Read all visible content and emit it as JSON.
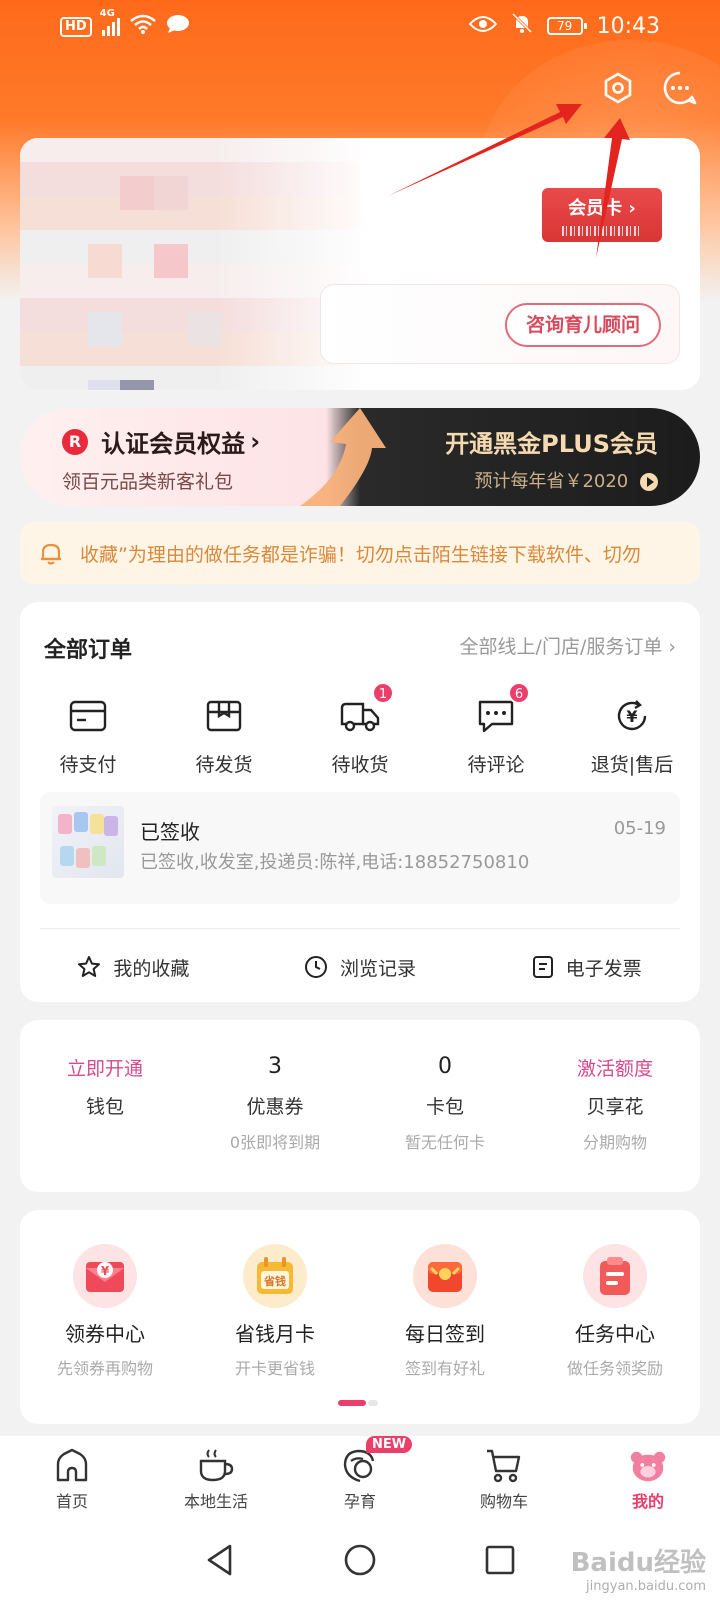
{
  "status_bar": {
    "hd": "HD",
    "network": "4G",
    "battery": "79",
    "time": "10:43"
  },
  "profile": {
    "member_card_label": "会员卡",
    "advisor_button": "咨询育儿顾问"
  },
  "banner": {
    "left_title": "认证会员权益",
    "left_sub": "领百元品类新客礼包",
    "right_title": "开通黑金PLUS会员",
    "right_sub": "预计每年省￥2020",
    "r_letter": "R"
  },
  "notice": {
    "text": "收藏”为理由的做任务都是诈骗！切勿点击陌生链接下载软件、切勿"
  },
  "orders": {
    "title": "全部订单",
    "all_link": "全部线上/门店/服务订单",
    "items": [
      {
        "label": "待支付",
        "badge": ""
      },
      {
        "label": "待发货",
        "badge": ""
      },
      {
        "label": "待收货",
        "badge": "1"
      },
      {
        "label": "待评论",
        "badge": "6"
      },
      {
        "label": "退货|售后",
        "badge": ""
      }
    ],
    "shipment": {
      "status": "已签收",
      "date": "05-19",
      "detail": "已签收,收发室,投递员:陈祥,电话:18852750810"
    },
    "quick_links": [
      "我的收藏",
      "浏览记录",
      "电子发票"
    ]
  },
  "wallet": [
    {
      "value": "立即开通",
      "name": "钱包",
      "sub": ""
    },
    {
      "value": "3",
      "name": "优惠券",
      "sub": "0张即将到期"
    },
    {
      "value": "0",
      "name": "卡包",
      "sub": "暂无任何卡"
    },
    {
      "value": "激活额度",
      "name": "贝享花",
      "sub": "分期购物"
    }
  ],
  "tasks": [
    {
      "name": "领券中心",
      "sub": "先领券再购物"
    },
    {
      "name": "省钱月卡",
      "sub": "开卡更省钱",
      "icon_text": "省钱"
    },
    {
      "name": "每日签到",
      "sub": "签到有好礼"
    },
    {
      "name": "任务中心",
      "sub": "做任务领奖励"
    }
  ],
  "tabbar": {
    "new_badge": "NEW",
    "tabs": [
      "首页",
      "本地生活",
      "孕育",
      "购物车",
      "我的"
    ],
    "active": "我的"
  },
  "watermark": {
    "logo": "Baidu经验",
    "url": "jingyan.baidu.com"
  },
  "colors": {
    "header_orange": "#ff6a1a",
    "accent_pink": "#ec3e6a",
    "banner_dark": "#1c1c1c",
    "notice_text": "#d9893a"
  }
}
